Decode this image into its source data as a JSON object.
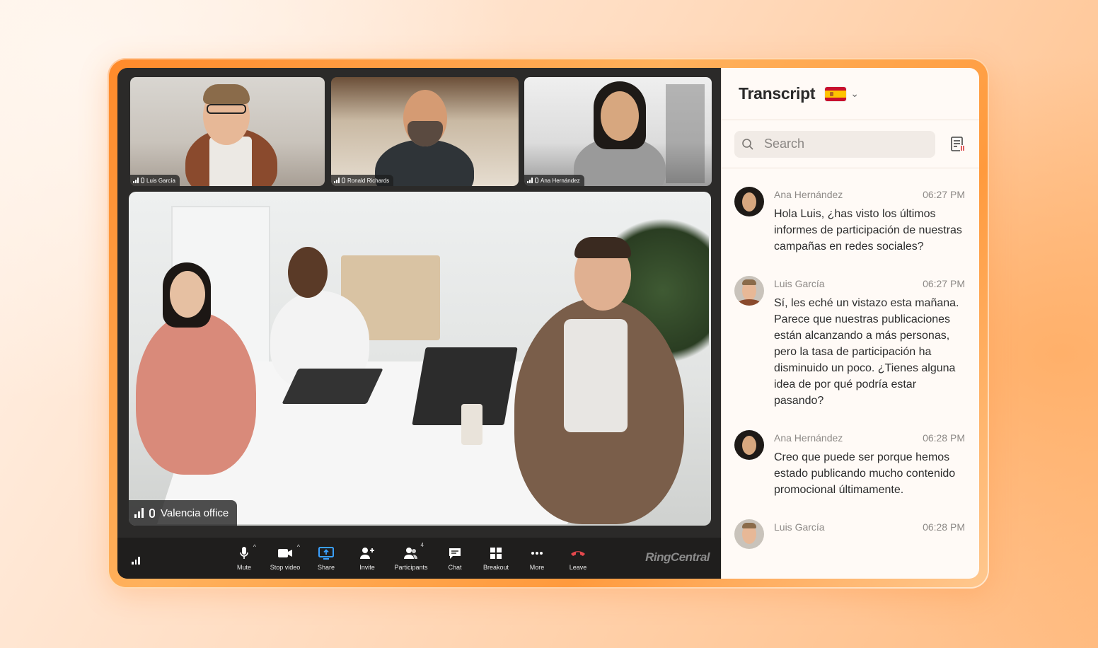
{
  "meeting": {
    "participants": [
      {
        "name": "Luis García"
      },
      {
        "name": "Ronald Richards"
      },
      {
        "name": "Ana Hernández"
      }
    ],
    "main_room": "Valencia office"
  },
  "toolbar": {
    "mute": "Mute",
    "stop_video": "Stop video",
    "share": "Share",
    "invite": "Invite",
    "participants": "Participants",
    "participants_count": "4",
    "chat": "Chat",
    "breakout": "Breakout",
    "more": "More",
    "leave": "Leave",
    "brand": "RingCentral"
  },
  "transcript": {
    "title": "Transcript",
    "language_flag": "spain-flag",
    "search_placeholder": "Search",
    "messages": [
      {
        "speaker": "Ana Hernández",
        "time": "06:27 PM",
        "text": "Hola Luis, ¿has visto los últimos informes de participación de nuestras campañas en redes sociales?"
      },
      {
        "speaker": "Luis García",
        "time": "06:27 PM",
        "text": "Sí, les eché un vistazo esta mañana. Parece que nuestras publicaciones están alcanzando a más personas, pero la tasa de participación ha disminuido un poco. ¿Tienes alguna idea de por qué podría estar pasando?"
      },
      {
        "speaker": "Ana Hernández",
        "time": "06:28 PM",
        "text": "Creo que puede ser porque hemos estado publicando mucho contenido promocional últimamente."
      },
      {
        "speaker": "Luis García",
        "time": "06:28 PM",
        "text": ""
      }
    ]
  },
  "colors": {
    "accent_orange": "#ff8a2a",
    "share_blue": "#3aa0ff",
    "leave_red": "#e5484d"
  }
}
